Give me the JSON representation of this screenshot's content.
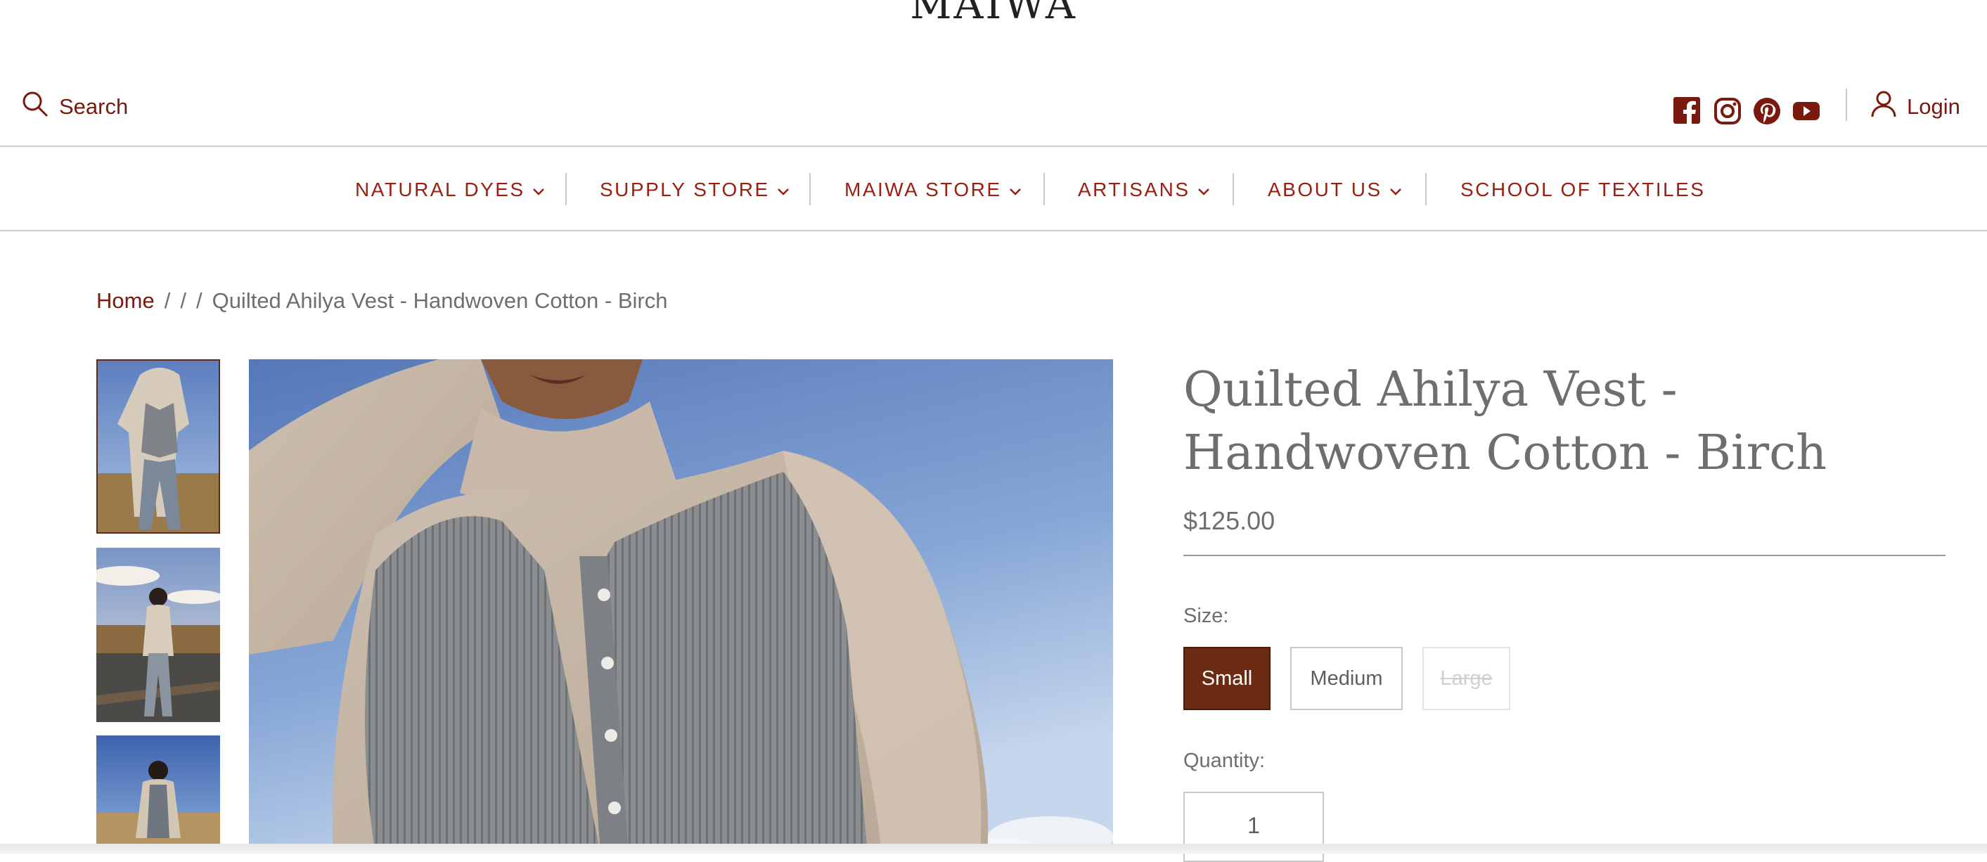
{
  "header": {
    "brand": "MAIWA",
    "search_label": "Search",
    "login_label": "Login",
    "social_icons": [
      "facebook-icon",
      "instagram-icon",
      "pinterest-icon",
      "youtube-icon"
    ]
  },
  "nav": {
    "items": [
      {
        "label": "NATURAL DYES"
      },
      {
        "label": "SUPPLY STORE"
      },
      {
        "label": "MAIWA STORE"
      },
      {
        "label": "ARTISANS"
      },
      {
        "label": "ABOUT US"
      },
      {
        "label": "SCHOOL OF TEXTILES"
      }
    ]
  },
  "breadcrumb": {
    "home": "Home",
    "sep": "/",
    "current": "Quilted Ahilya Vest - Handwoven Cotton - Birch"
  },
  "product": {
    "title": "Quilted Ahilya Vest - Handwoven Cotton - Birch",
    "price": "$125.00",
    "size_label": "Size:",
    "sizes": [
      {
        "label": "Small"
      },
      {
        "label": "Medium"
      },
      {
        "label": "Large"
      }
    ],
    "selected_size": "Small",
    "quantity_label": "Quantity:",
    "quantity": "1"
  },
  "colors": {
    "accent": "#7a1a0e",
    "nav_text": "#9b1e10",
    "selected_size_bg": "#6b2a12"
  }
}
